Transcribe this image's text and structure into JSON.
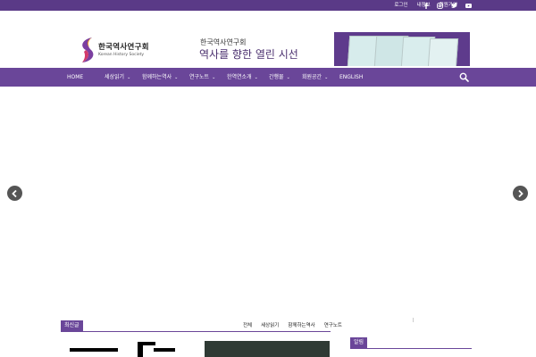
{
  "topbar": {
    "links": [
      "로그인",
      "내정보",
      "회원가입"
    ],
    "social": [
      "facebook-icon",
      "instagram-icon",
      "twitter-icon",
      "youtube-icon"
    ]
  },
  "logo": {
    "korean": "한국역사연구회",
    "english": "Korean History Society"
  },
  "header": {
    "tagline_sub": "한국역사연구회",
    "tagline_main": "역사를 향한 열린 시선"
  },
  "nav": {
    "items": [
      {
        "label": "HOME",
        "dropdown": false
      },
      {
        "label": "세상읽기",
        "dropdown": true
      },
      {
        "label": "함께하는역사",
        "dropdown": true
      },
      {
        "label": "연구노트",
        "dropdown": true
      },
      {
        "label": "한역연소개",
        "dropdown": true
      },
      {
        "label": "간행물",
        "dropdown": true
      },
      {
        "label": "회원공간",
        "dropdown": true
      },
      {
        "label": "ENGLISH",
        "dropdown": false
      }
    ]
  },
  "latest": {
    "label": "최신글",
    "tabs": [
      "전체",
      "세상읽기",
      "함께하는역사",
      "연구노트"
    ]
  },
  "notice": {
    "label": "알림"
  },
  "colors": {
    "brand_purple": "#6a4699",
    "topbar_purple": "#5a3a87",
    "arrow_gray": "#555555"
  }
}
